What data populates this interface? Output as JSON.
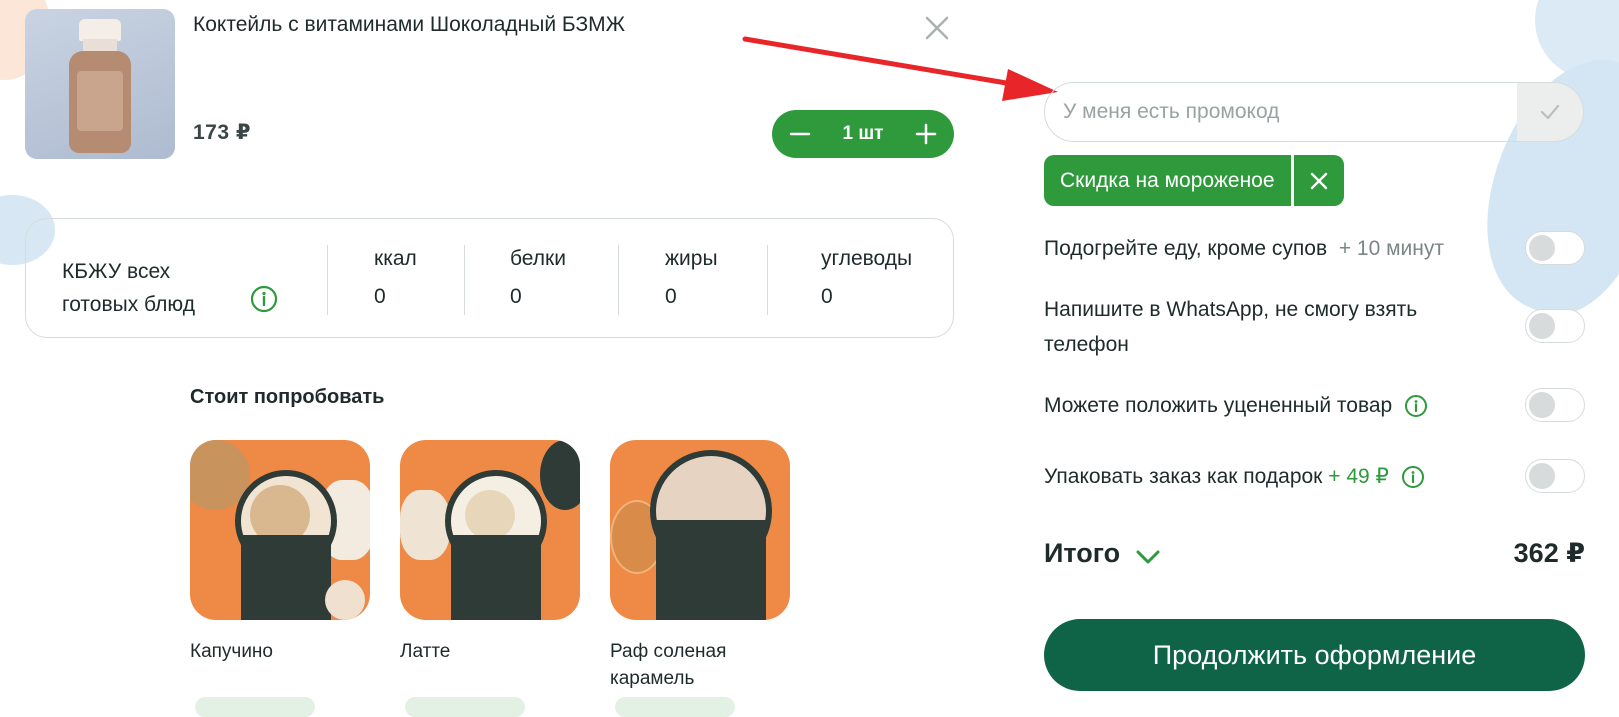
{
  "product": {
    "title": "Коктейль с витаминами Шоколадный БЗМЖ",
    "price": "173 ₽",
    "quantity": "1 шт",
    "image_icon": "chocolate-milk-bottle-image",
    "remove_icon": "close-icon"
  },
  "nutrition": {
    "title": "КБЖУ всех готовых блюд",
    "columns": [
      {
        "label": "ккал",
        "value": "0"
      },
      {
        "label": "белки",
        "value": "0"
      },
      {
        "label": "жиры",
        "value": "0"
      },
      {
        "label": "углеводы",
        "value": "0"
      }
    ]
  },
  "recommendations": {
    "title": "Стоит попробовать",
    "items": [
      {
        "name": "Капучино"
      },
      {
        "name": "Латте"
      },
      {
        "name": "Раф соленая карамель"
      }
    ]
  },
  "promo": {
    "placeholder": "У меня есть промокод",
    "applied_coupon": "Скидка на мороженое"
  },
  "options": [
    {
      "label": "Подогрейте еду, кроме супов",
      "extra": "+ 10 минут",
      "enabled": false
    },
    {
      "label": "Напишите в WhatsApp, не смогу взять телефон",
      "extra": "",
      "enabled": false
    },
    {
      "label": "Можете положить уцененный товар",
      "extra": "",
      "enabled": false
    },
    {
      "label": "Упаковать заказ как подарок",
      "extra": "+ 49 ₽",
      "enabled": false
    }
  ],
  "total": {
    "label": "Итого",
    "value": "362 ₽"
  },
  "checkout_button": "Продолжить оформление",
  "colors": {
    "primary_green": "#2e9a3c",
    "dark_green": "#0f6347",
    "annotation_arrow": "#e8262a"
  }
}
